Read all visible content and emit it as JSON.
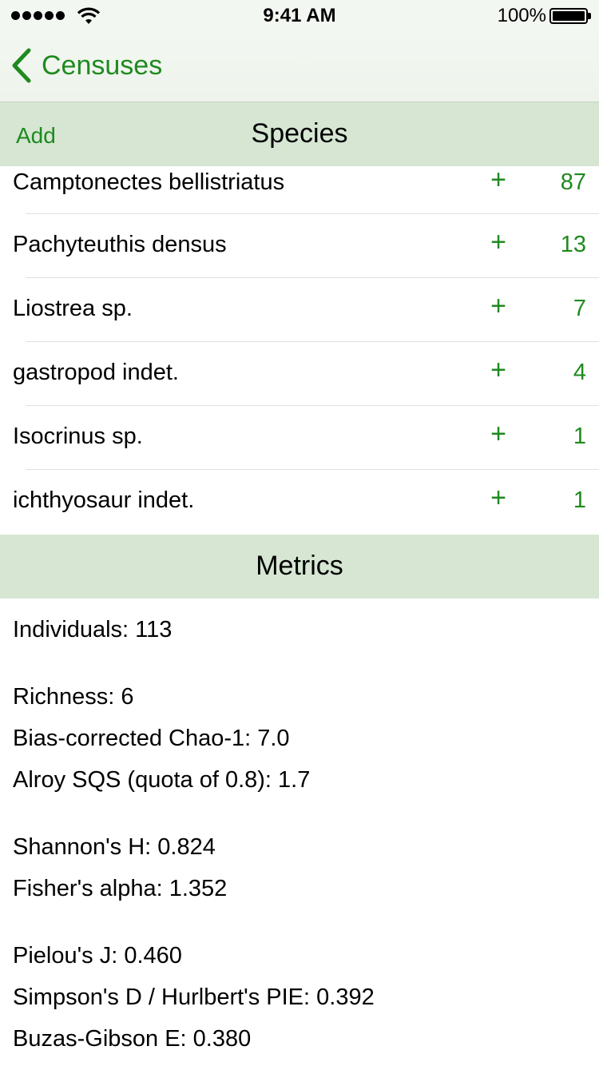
{
  "status_bar": {
    "time": "9:41 AM",
    "battery_percent": "100%"
  },
  "nav": {
    "back_label": "Censuses"
  },
  "species_section": {
    "title": "Species",
    "add_label": "Add",
    "plus_label": "+",
    "rows": [
      {
        "name": "Camptonectes bellistriatus",
        "count": "87"
      },
      {
        "name": "Pachyteuthis densus",
        "count": "13"
      },
      {
        "name": "Liostrea sp.",
        "count": "7"
      },
      {
        "name": "gastropod indet.",
        "count": "4"
      },
      {
        "name": "Isocrinus sp.",
        "count": "1"
      },
      {
        "name": "ichthyosaur indet.",
        "count": "1"
      }
    ]
  },
  "metrics_section": {
    "title": "Metrics",
    "lines": [
      "Individuals: 113",
      "Richness: 6",
      "Bias-corrected Chao-1: 7.0",
      "Alroy SQS (quota of 0.8): 1.7",
      "Shannon's H: 0.824",
      "Fisher's alpha: 1.352",
      "Pielou's J: 0.460",
      "Simpson's D / Hurlbert's PIE: 0.392",
      "Buzas-Gibson E: 0.380"
    ]
  },
  "colors": {
    "accent": "#1f8a1f",
    "section_header_bg": "#d6e6d3",
    "nav_bg": "#f3f7f1"
  }
}
